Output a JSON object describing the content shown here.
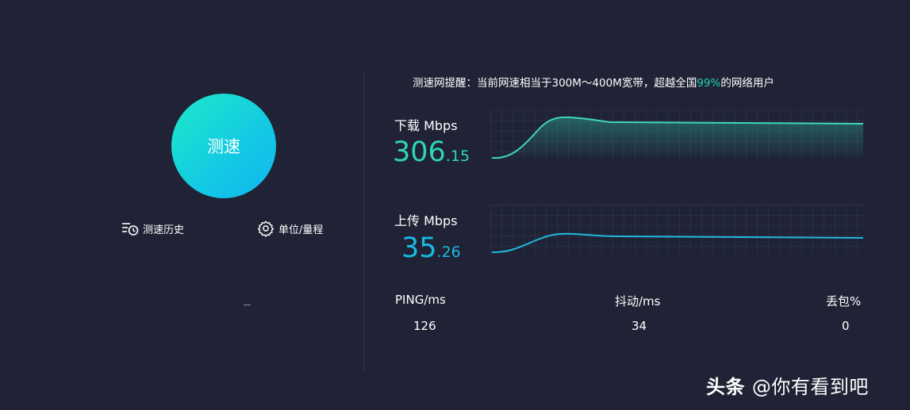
{
  "left": {
    "start_button": "测速",
    "history_label": "测速历史",
    "settings_label": "单位/量程"
  },
  "tip": {
    "prefix": "测速网提醒：当前网速相当于300M～400M宽带，超越全国",
    "percent": "99%",
    "suffix": "的网络用户"
  },
  "download": {
    "label": "下载 Mbps",
    "value_int": "306",
    "value_dec": ".15",
    "color": "#2fd6b1"
  },
  "upload": {
    "label": "上传 Mbps",
    "value_int": "35",
    "value_dec": ".26",
    "color": "#1ab9e6"
  },
  "stats": {
    "ping_label": "PING/ms",
    "ping_value": "126",
    "jitter_label": "抖动/ms",
    "jitter_value": "34",
    "loss_label": "丢包%",
    "loss_value": "0"
  },
  "watermark": {
    "brand": "头条",
    "handle": "@你有看到吧"
  },
  "colors": {
    "background": "#1f2335",
    "accent": "#24d2b0",
    "button_gradient_start": "#1fe9c8",
    "button_gradient_end": "#12b6f0"
  }
}
